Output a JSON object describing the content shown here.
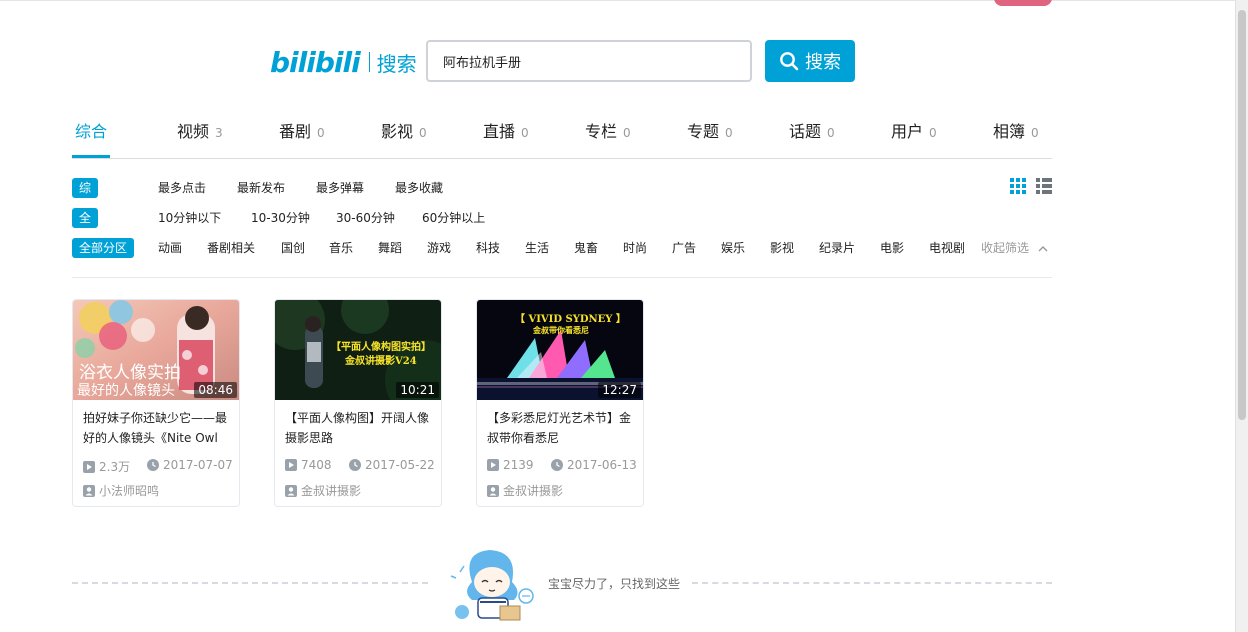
{
  "header": {
    "logo_text": "bilibili",
    "logo_sub": "搜索",
    "search_value": "阿布拉机手册",
    "search_button": "搜索"
  },
  "tabs": [
    {
      "label": "综合",
      "count": ""
    },
    {
      "label": "视频",
      "count": "3"
    },
    {
      "label": "番剧",
      "count": "0"
    },
    {
      "label": "影视",
      "count": "0"
    },
    {
      "label": "直播",
      "count": "0"
    },
    {
      "label": "专栏",
      "count": "0"
    },
    {
      "label": "专题",
      "count": "0"
    },
    {
      "label": "话题",
      "count": "0"
    },
    {
      "label": "用户",
      "count": "0"
    },
    {
      "label": "相簿",
      "count": "0"
    }
  ],
  "filters": {
    "order": {
      "active": "综合排序",
      "options": [
        "最多点击",
        "最新发布",
        "最多弹幕",
        "最多收藏"
      ]
    },
    "duration": {
      "active": "全部时长",
      "options": [
        "10分钟以下",
        "10-30分钟",
        "30-60分钟",
        "60分钟以上"
      ]
    },
    "zone": {
      "active": "全部分区",
      "options": [
        "动画",
        "番剧相关",
        "国创",
        "音乐",
        "舞蹈",
        "游戏",
        "科技",
        "生活",
        "鬼畜",
        "时尚",
        "广告",
        "娱乐",
        "影视",
        "纪录片",
        "电影",
        "电视剧"
      ],
      "collapse": "收起筛选"
    }
  },
  "videos": [
    {
      "thumb_line1": "浴衣人像实拍",
      "thumb_line2": "最好的人像镜头",
      "duration": "08:46",
      "title": "拍好妹子你还缺少它——最好的人像镜头《Nite Owl",
      "plays": "2.3万",
      "date": "2017-07-07",
      "author": "小法师昭鸣"
    },
    {
      "thumb_line1": "【平面人像构图实拍】",
      "thumb_line2": "金叔讲摄影V24",
      "duration": "10:21",
      "title": "【平面人像构图】开阔人像摄影思路",
      "plays": "7408",
      "date": "2017-05-22",
      "author": "金叔讲摄影"
    },
    {
      "thumb_line1": "【 VIVID SYDNEY 】",
      "thumb_line2": "金叔带你看悉尼",
      "duration": "12:27",
      "title": "【多彩悉尼灯光艺术节】金叔带你看悉尼",
      "plays": "2139",
      "date": "2017-06-13",
      "author": "金叔讲摄影"
    }
  ],
  "footer": {
    "end_text": "宝宝尽力了，只找到这些"
  },
  "colors": {
    "accent": "#00a1d6",
    "pink": "#e0637f"
  }
}
